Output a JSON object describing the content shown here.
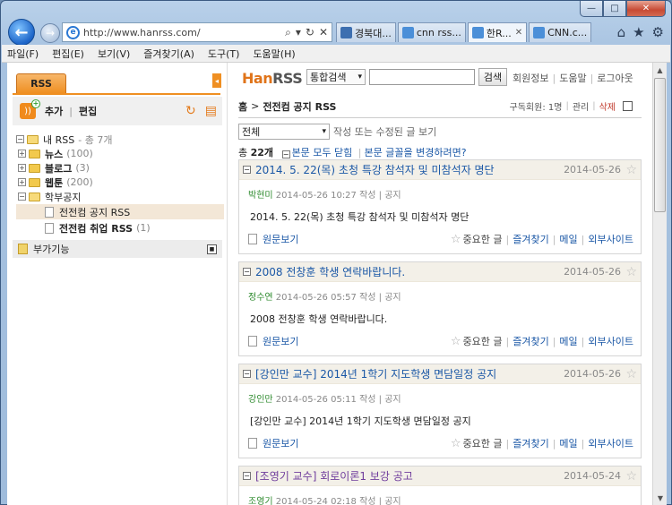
{
  "browser": {
    "address": "http://www.hanrss.com/",
    "tabs": [
      {
        "label": "경북대...",
        "color": "#3d6fb0"
      },
      {
        "label": "cnn rss...",
        "color": "#4b8fd8"
      },
      {
        "label": "한R...",
        "color": "#4b8fd8"
      },
      {
        "label": "CNN.c...",
        "color": "#4b8fd8"
      }
    ],
    "menus": [
      "파일(F)",
      "편집(E)",
      "보기(V)",
      "즐겨찾기(A)",
      "도구(T)",
      "도움말(H)"
    ]
  },
  "left": {
    "rss_tab": "RSS",
    "add": "추가",
    "edit": "편집",
    "root": "내 RSS",
    "root_count": "- 총 7개",
    "folders": [
      {
        "name": "뉴스",
        "count": "(100)"
      },
      {
        "name": "블로그",
        "count": "(3)"
      },
      {
        "name": "웹툰",
        "count": "(200)"
      }
    ],
    "open_folder": "학부공지",
    "feeds": [
      {
        "name": "전전컴 공지 RSS",
        "count": ""
      },
      {
        "name": "전전컴 취업 RSS",
        "count": "(1)"
      }
    ],
    "extras": "부가기능"
  },
  "header": {
    "logo_a": "Han",
    "logo_b": "RSS",
    "search_scope": "통합검색",
    "search_button": "검색",
    "links": [
      "회원정보",
      "도움말",
      "로그아웃"
    ]
  },
  "crumb": {
    "home": "홈",
    "title": "전전컴 공지 RSS",
    "subscribers": "구독회원: 1명",
    "manage": "관리",
    "delete": "삭제"
  },
  "filter": {
    "value": "전체",
    "hint": "작성 또는 수정된 글 보기"
  },
  "totals": {
    "prefix": "총",
    "count": "22개",
    "collapse_all": "본문 모두 닫힘",
    "change_font": "본문 글꼴을 변경하려면?"
  },
  "actions": {
    "original": "원문보기",
    "important": "중요한 글",
    "favorite": "즐겨찾기",
    "mail": "메일",
    "external": "외부사이트"
  },
  "posts": [
    {
      "title": "2014. 5. 22(목) 초청 특강 참석자 및 미참석자 명단",
      "date": "2014-05-26",
      "author": "박현미",
      "meta": "2014-05-26 10:27 작성 | 공지",
      "body": "2014. 5. 22(목) 초청 특강 참석자 및 미참석자 명단"
    },
    {
      "title": "2008 전창훈 학생 연락바랍니다.",
      "date": "2014-05-26",
      "author": "정수연",
      "meta": "2014-05-26 05:57 작성 | 공지",
      "body": "2008 전창훈 학생 연락바랍니다."
    },
    {
      "title": "[강인만 교수] 2014년 1학기 지도학생 면담일정 공지",
      "date": "2014-05-26",
      "author": "강인만",
      "meta": "2014-05-26 05:11 작성 | 공지",
      "body": "[강인만 교수] 2014년 1학기 지도학생 면담일정 공지"
    },
    {
      "title": "[조영기 교수] 회로이론1 보강 공고",
      "date": "2014-05-24",
      "author": "조영기",
      "meta": "2014-05-24 02:18 작성 | 공지",
      "body": ""
    }
  ]
}
